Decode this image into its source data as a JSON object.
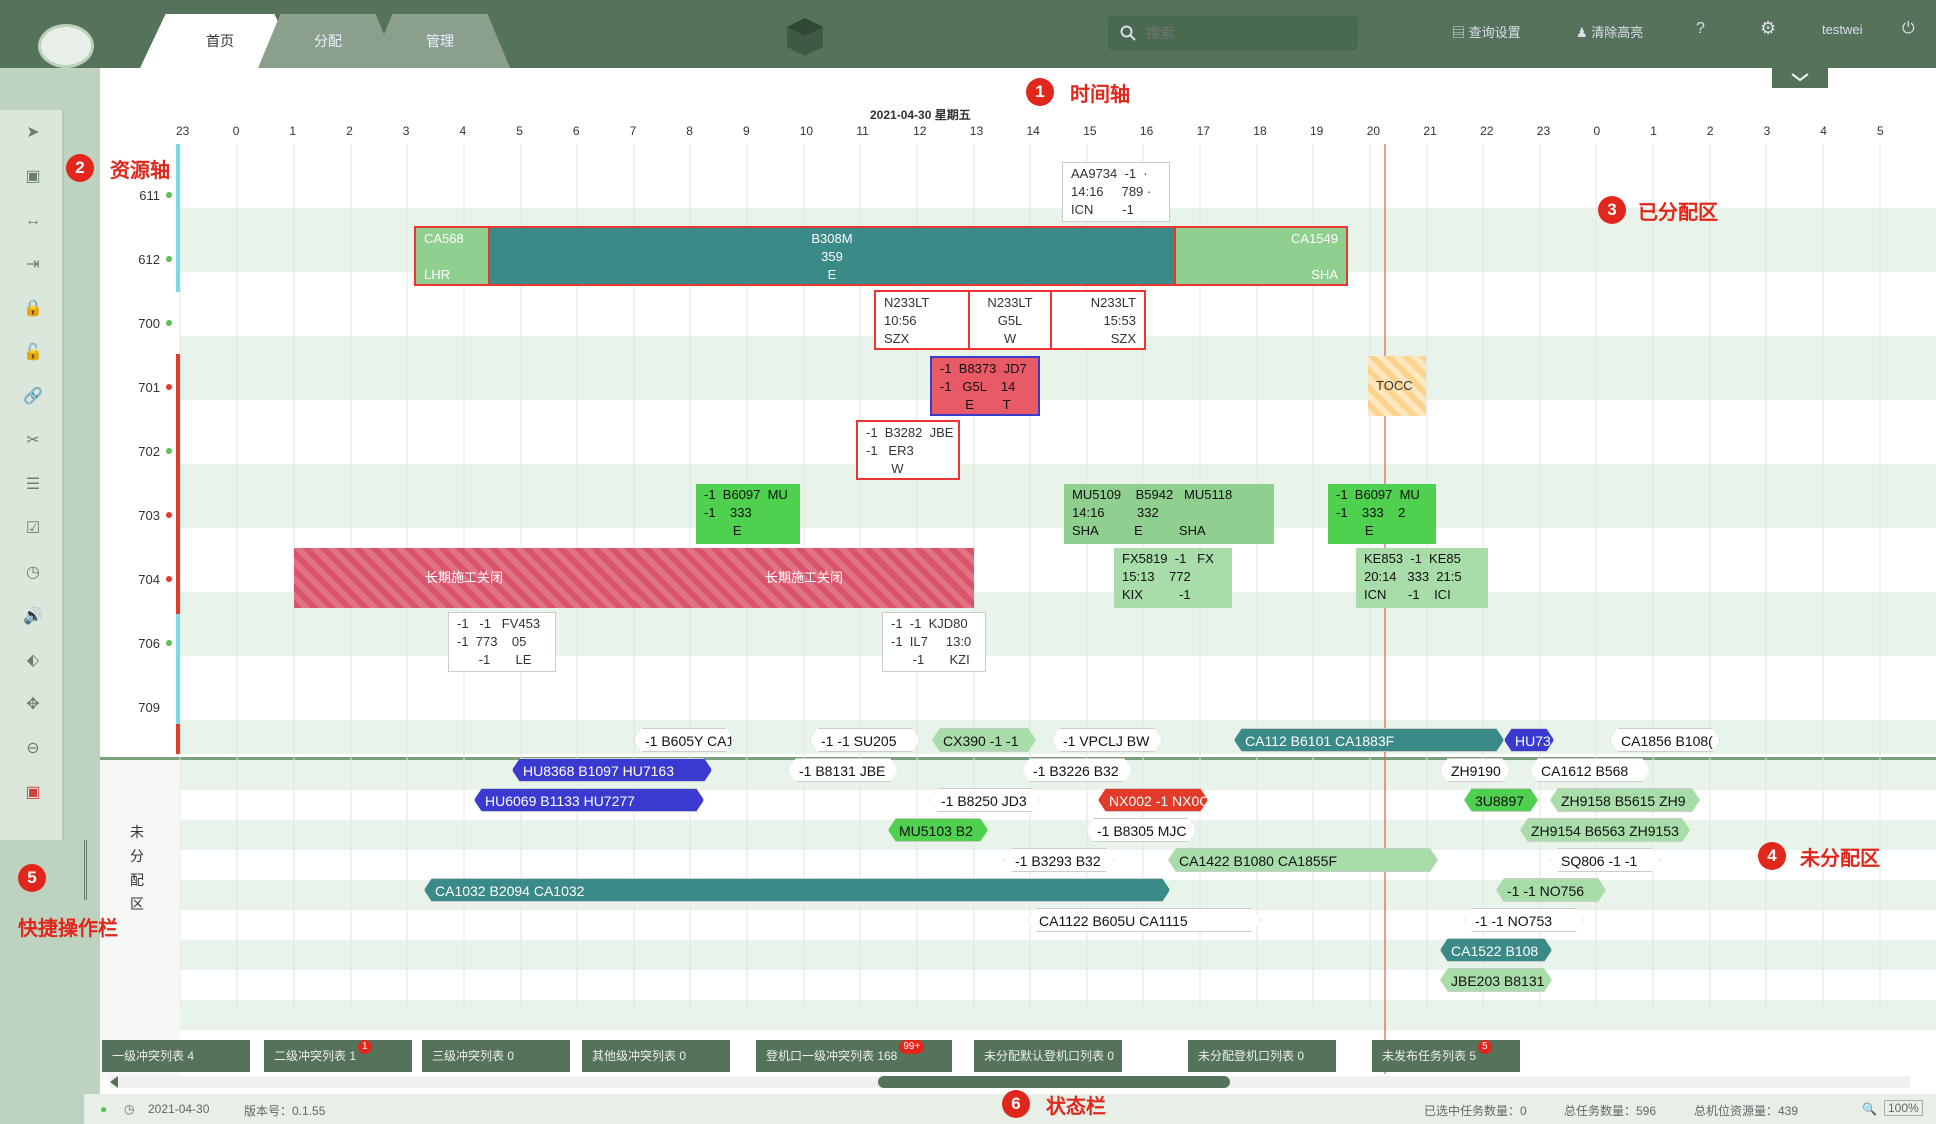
{
  "header": {
    "tabs": [
      "首页",
      "分配",
      "管理"
    ],
    "search_placeholder": "搜索",
    "query_settings": "查询设置",
    "clear_highlight": "清除高亮",
    "user": "testwei"
  },
  "timeline": {
    "date": "2021-04-30 星期五",
    "hours": [
      "23",
      "0",
      "1",
      "2",
      "3",
      "4",
      "5",
      "6",
      "7",
      "8",
      "9",
      "10",
      "11",
      "12",
      "13",
      "14",
      "15",
      "16",
      "17",
      "18",
      "19",
      "20",
      "21",
      "22",
      "23",
      "0",
      "1",
      "2",
      "3",
      "4",
      "5"
    ]
  },
  "resources": [
    "611",
    "612",
    "700",
    "701",
    "702",
    "703",
    "704",
    "706",
    "709"
  ],
  "unassigned_label": "未分配区",
  "annotations": {
    "m1": "1",
    "l1": "时间轴",
    "m2": "2",
    "l2": "资源轴",
    "m3": "3",
    "l3": "已分配区",
    "m4": "4",
    "l4": "未分配区",
    "m5": "5",
    "l5": "快捷操作栏",
    "m6": "6",
    "l6": "状态栏"
  },
  "assigned": {
    "b611": "AA9734  -1  ·\n14:16     789 ·\nICN        -1",
    "b612a": "CA568\n\nLHR",
    "b612b": "B308M\n359\nE",
    "b612c": "CA1549\n\nSHA",
    "b700a": "N233LT\n10:56\nSZX",
    "b700b": "N233LT\nG5L\nW",
    "b700c": "N233LT\n15:53\nSZX",
    "b701": "-1  B8373  JD7\n-1   G5L    14\n       E        T",
    "tocc": "TOCC",
    "b702": "-1  B3282  JBE\n-1   ER3\n       W",
    "b703a": "-1  B6097  MU\n-1    333\n        E",
    "b703b": "MU5109    B5942   MU5118\n14:16         332\nSHA          E          SHA",
    "b703c": "-1  B6097  MU\n-1    333    2\n        E",
    "close1": "长期施工关闭",
    "close2": "长期施工关闭",
    "b704a": "FX5819  -1   FX\n15:13    772\nKIX          -1",
    "b704b": "KE853  -1  KE85\n20:14   333  21:5\nICN      -1    ICI",
    "b706a": "-1   -1   FV453\n-1  773    05\n      -1       LE",
    "b706b": "-1  -1  KJD80\n-1  IL7     13:0\n      -1       KZI"
  },
  "unassigned": [
    {
      "t": "-1  B605Y  CA1"
    },
    {
      "t": "-1   -1   SU205"
    },
    {
      "t": "CX390   -1   -1"
    },
    {
      "t": "-1  VPCLJ  BW"
    },
    {
      "t": "CA112          B6101          CA1883F"
    },
    {
      "t": "HU73"
    },
    {
      "t": "CA1856  B108("
    },
    {
      "t": "HU8368     B1097     HU7163"
    },
    {
      "t": "-1  B8131  JBE"
    },
    {
      "t": "-1  B3226  B32"
    },
    {
      "t": "ZH9190"
    },
    {
      "t": "CA1612  B568"
    },
    {
      "t": "HU6069        B1133        HU7277"
    },
    {
      "t": "-1  B8250  JD3"
    },
    {
      "t": "NX002  -1  NX0C"
    },
    {
      "t": "3U8897"
    },
    {
      "t": "ZH9158  B5615  ZH9"
    },
    {
      "t": "MU5103  B2"
    },
    {
      "t": "-1  B8305  MJC"
    },
    {
      "t": "ZH9154  B6563  ZH9153"
    },
    {
      "t": "-1  B3293  B32"
    },
    {
      "t": "CA1422                  B1080                  CA1855F"
    },
    {
      "t": "SQ806   -1   -1"
    },
    {
      "t": "CA1032                                          B2094                                                                          CA1032"
    },
    {
      "t": "-1   -1   NO756"
    },
    {
      "t": "CA1122          B605U          CA1115"
    },
    {
      "t": "-1   -1   NO753"
    },
    {
      "t": "CA1522  B108"
    },
    {
      "t": "JBE203  B8131"
    }
  ],
  "bottom_tabs": [
    {
      "label": "一级冲突列表 4",
      "badge": ""
    },
    {
      "label": "二级冲突列表 1",
      "badge": "1"
    },
    {
      "label": "三级冲突列表 0",
      "badge": ""
    },
    {
      "label": "其他级冲突列表 0",
      "badge": ""
    },
    {
      "label": "登机口一级冲突列表 168",
      "badge": "99+"
    },
    {
      "label": "未分配默认登机口列表 0",
      "badge": ""
    },
    {
      "label": "未分配登机口列表 0",
      "badge": ""
    },
    {
      "label": "未发布任务列表 5",
      "badge": "5"
    }
  ],
  "status": {
    "date": "2021-04-30",
    "version": "版本号：0.1.55",
    "selected": "已选中任务数量：0",
    "total_tasks": "总任务数量：596",
    "total_resources": "总机位资源量：439",
    "zoom": "100%"
  }
}
